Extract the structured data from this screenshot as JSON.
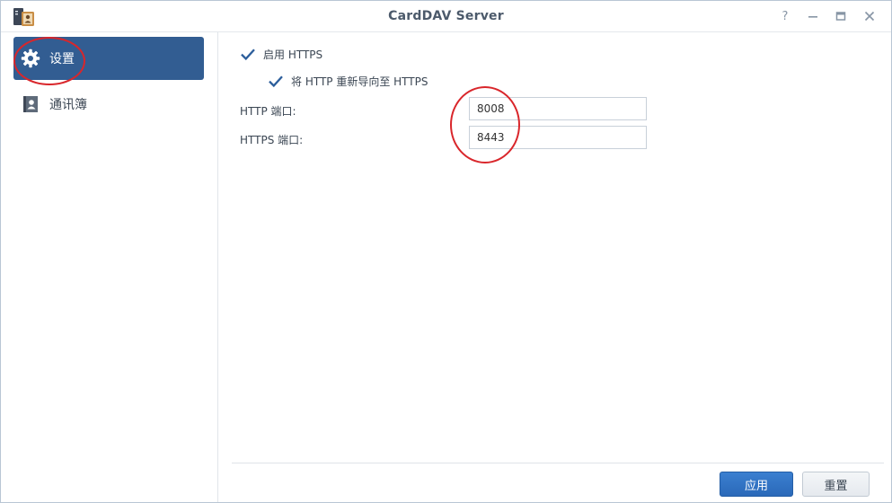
{
  "window": {
    "title": "CardDAV Server"
  },
  "titlebar": {
    "help": "?",
    "minimize": "—",
    "close": "✕"
  },
  "sidebar": {
    "items": [
      {
        "label": "设置",
        "icon": "gear-icon",
        "active": true
      },
      {
        "label": "通讯簿",
        "icon": "contact-book-icon",
        "active": false
      }
    ]
  },
  "settings": {
    "enable_https_label": "启用 HTTPS",
    "enable_https_checked": true,
    "redirect_label": "将 HTTP 重新导向至 HTTPS",
    "redirect_checked": true,
    "http_port_label": "HTTP 端口:",
    "http_port_value": "8008",
    "https_port_label": "HTTPS 端口:",
    "https_port_value": "8443"
  },
  "footer": {
    "apply_label": "应用",
    "reset_label": "重置"
  },
  "colors": {
    "accent": "#325d92",
    "primary_button": "#2f72c4",
    "annotation": "#d9262b",
    "checkmark": "#2c5e9b"
  }
}
